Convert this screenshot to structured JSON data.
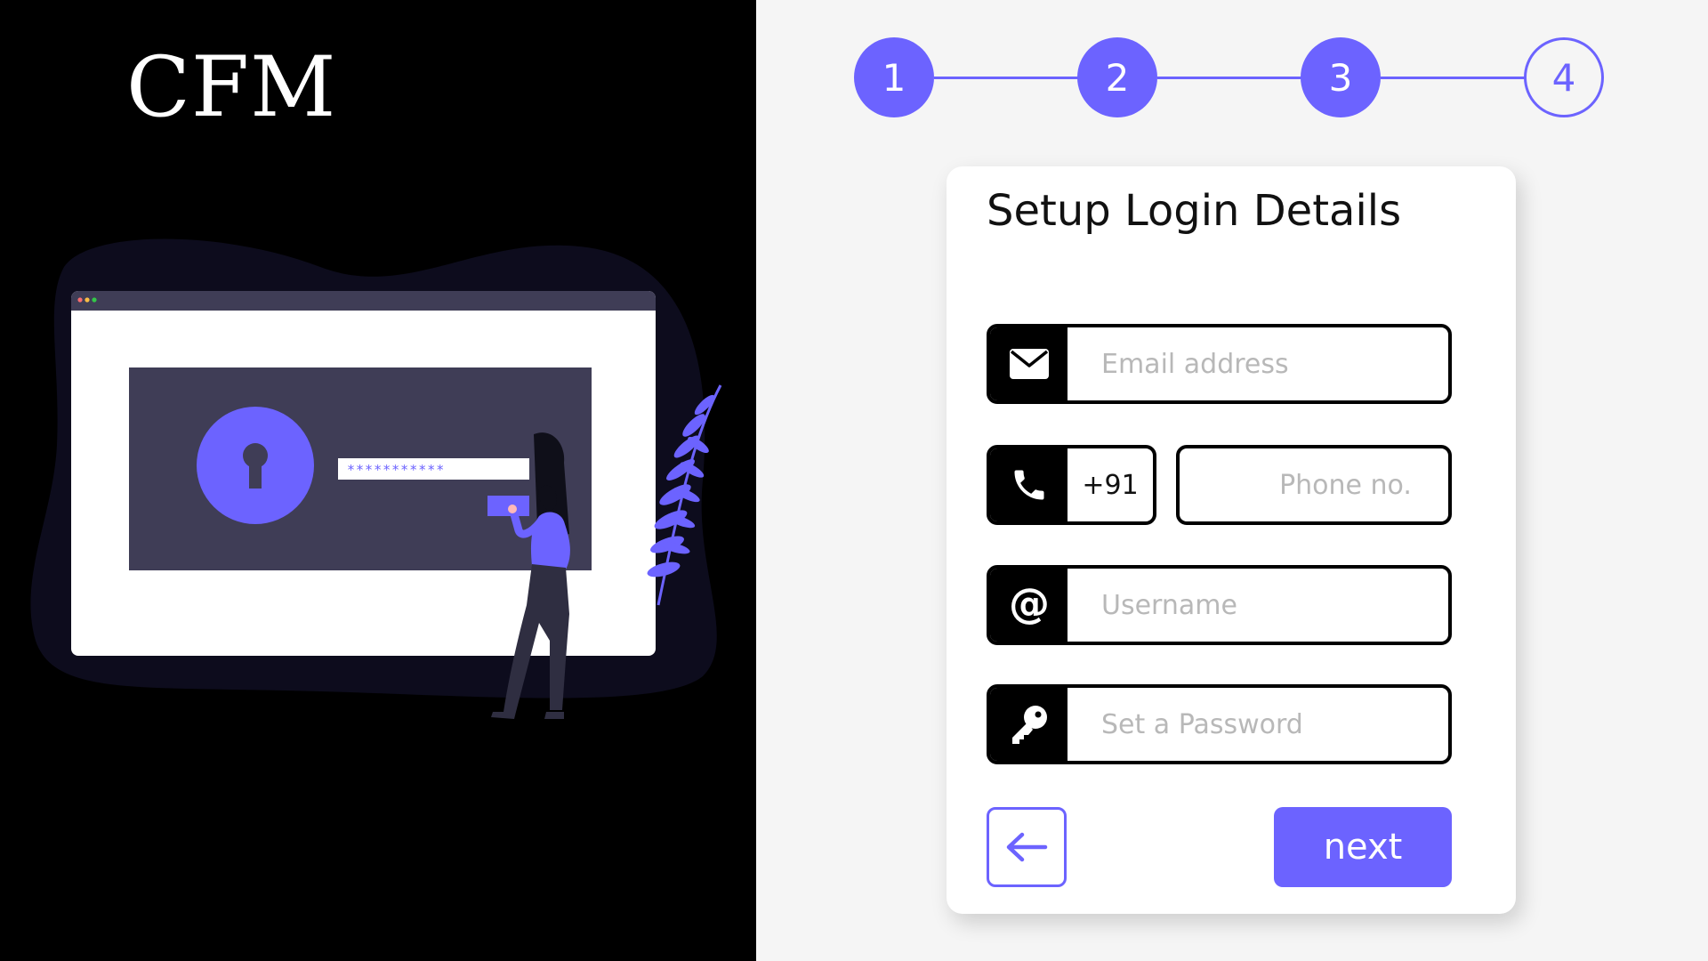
{
  "brand": {
    "logo_text": "CFM"
  },
  "illustration": {
    "password_mask": "***********",
    "accent_color": "#6c63ff"
  },
  "stepper": {
    "steps": [
      {
        "label": "1",
        "state": "completed"
      },
      {
        "label": "2",
        "state": "completed"
      },
      {
        "label": "3",
        "state": "completed"
      },
      {
        "label": "4",
        "state": "current"
      }
    ]
  },
  "form": {
    "title": "Setup Login Details",
    "email": {
      "placeholder": "Email address",
      "icon": "envelope-icon"
    },
    "phone": {
      "country_code": "+91",
      "placeholder": "Phone no.",
      "icon": "phone-icon"
    },
    "username": {
      "placeholder": "Username",
      "icon": "at-sign-icon"
    },
    "password": {
      "placeholder": "Set a Password",
      "icon": "key-icon"
    },
    "back_button": {
      "icon": "arrow-left-icon"
    },
    "next_button": {
      "label": "next"
    }
  },
  "colors": {
    "accent": "#6c63ff",
    "left_background": "#000000",
    "right_background": "#f5f5f5",
    "card_background": "#ffffff"
  }
}
